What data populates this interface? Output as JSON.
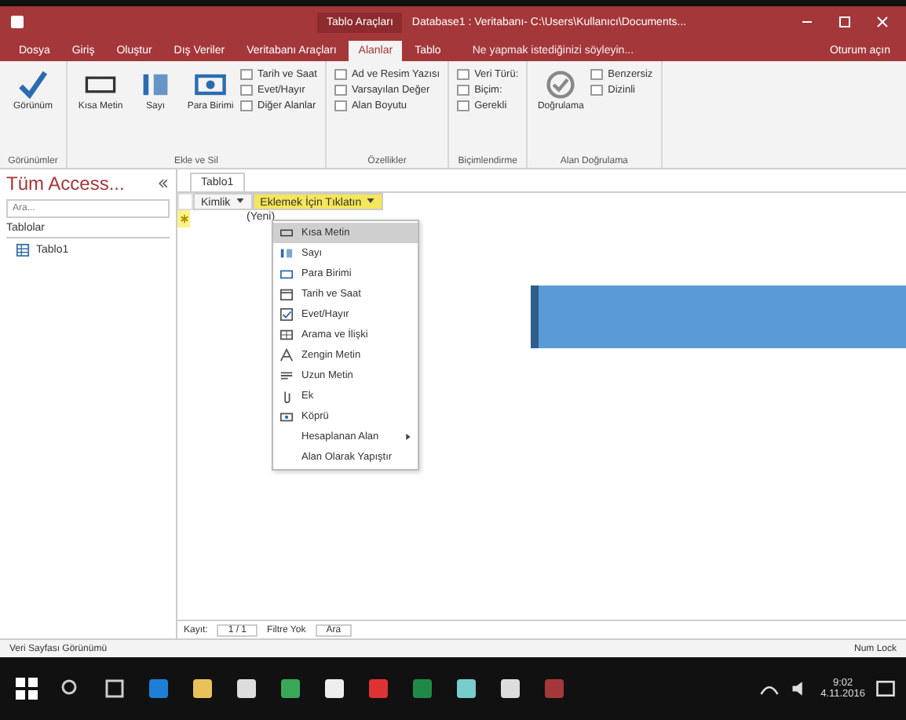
{
  "window": {
    "tools_title": "Tablo Araçları",
    "title": "Database1 : Veritabanı- C:\\Users\\Kullanıcı\\Documents...",
    "account": "Oturum açın"
  },
  "ribbon_tabs": [
    {
      "label": "Dosya",
      "selected": false
    },
    {
      "label": "Giriş",
      "selected": false
    },
    {
      "label": "Oluştur",
      "selected": false
    },
    {
      "label": "Dış Veriler",
      "selected": false
    },
    {
      "label": "Veritabanı Araçları",
      "selected": false
    },
    {
      "label": "Alanlar",
      "selected": true
    },
    {
      "label": "Tablo",
      "selected": false
    }
  ],
  "tell_me": "Ne yapmak istediğinizi söyleyin...",
  "ribbon_groups": [
    {
      "label": "Görünümler",
      "buttons": [
        {
          "kind": "view",
          "label": "Görünüm"
        }
      ]
    },
    {
      "label": "Ekle ve Sil",
      "buttons": [
        {
          "kind": "text",
          "label": "Kısa Metin"
        },
        {
          "kind": "number",
          "label": "Sayı"
        },
        {
          "kind": "currency",
          "label": "Para Birimi"
        }
      ],
      "small": [
        "Tarih ve Saat",
        "Evet/Hayır",
        "Diğer Alanlar"
      ]
    },
    {
      "label": "Özellikler",
      "small": [
        "Ad ve Resim Yazısı",
        "Varsayılan Değer",
        "Alan Boyutu"
      ]
    },
    {
      "label": "Biçimlendirme",
      "small": [
        "Veri Türü:",
        "Biçim:",
        "Gerekli"
      ]
    },
    {
      "label": "Alan Doğrulama",
      "small": [
        "Benzersiz",
        "Dizinli"
      ],
      "buttons": [
        {
          "kind": "validation",
          "label": "Doğrulama"
        }
      ]
    }
  ],
  "nav_pane": {
    "title": "Tüm Access...",
    "search_placeholder": "Ara...",
    "section": "Tablolar",
    "items": [
      "Tablo1"
    ]
  },
  "document_tab": "Tablo1",
  "columns": [
    {
      "label": "Kimlik",
      "highlighted": false
    },
    {
      "label": "Eklemek İçin Tıklatın",
      "highlighted": true
    }
  ],
  "new_row_cell": "(Yeni)",
  "menu": [
    {
      "kind": "text",
      "label": "Kısa Metin",
      "selected": true
    },
    {
      "kind": "number",
      "label": "Sayı",
      "selected": false
    },
    {
      "kind": "currency",
      "label": "Para Birimi",
      "selected": false
    },
    {
      "kind": "date",
      "label": "Tarih ve Saat",
      "selected": false
    },
    {
      "kind": "check",
      "label": "Evet/Hayır",
      "selected": false
    },
    {
      "kind": "lookup",
      "label": "Arama ve İlişki",
      "selected": false
    },
    {
      "kind": "rich",
      "label": "Zengin Metin",
      "selected": false
    },
    {
      "kind": "memo",
      "label": "Uzun Metin",
      "selected": false
    },
    {
      "kind": "clip",
      "label": "Ek",
      "selected": false
    },
    {
      "kind": "link",
      "label": "Köprü",
      "selected": false
    },
    {
      "kind": "submenu",
      "label": "Hesaplanan Alan",
      "selected": false
    },
    {
      "kind": "plain",
      "label": "Alan Olarak Yapıştır",
      "selected": false
    }
  ],
  "record_nav": {
    "label": "Kayıt:",
    "position": "1 / 1",
    "filter": "Filtre Yok",
    "search": "Ara"
  },
  "status": {
    "left": "Veri Sayfası Görünümü",
    "right": "Num Lock"
  },
  "taskbar": [
    {
      "kind": "start"
    },
    {
      "kind": "search"
    },
    {
      "kind": "taskview"
    },
    {
      "kind": "edge"
    },
    {
      "kind": "folder"
    },
    {
      "kind": "store"
    },
    {
      "kind": "chrome"
    },
    {
      "kind": "mail"
    },
    {
      "kind": "app"
    },
    {
      "kind": "excel"
    },
    {
      "kind": "photo"
    },
    {
      "kind": "notes"
    },
    {
      "kind": "access"
    }
  ],
  "clock": {
    "time": "9:02",
    "date": "4.11.2016"
  }
}
